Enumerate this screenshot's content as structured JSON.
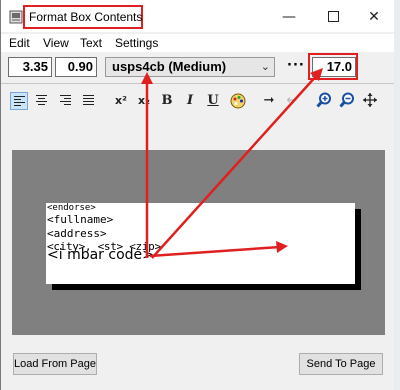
{
  "window": {
    "title": "Format Box Contents"
  },
  "menu": [
    "Edit",
    "View",
    "Text",
    "Settings"
  ],
  "fields": {
    "x": "3.35",
    "y": "0.90",
    "size": "17.0"
  },
  "font_select": {
    "value": "usps4cb (Medium)"
  },
  "dots_label": "···",
  "toolbar": [
    "align-left-icon",
    "align-center-icon",
    "align-right-icon",
    "justify-icon",
    "superscript-icon",
    "subscript-icon",
    "bold-icon",
    "italic-icon",
    "underline-icon",
    "color-palette-icon",
    "arrow-right-icon",
    "arrow-left-icon",
    "zoom-in-icon",
    "zoom-out-icon",
    "move-icon"
  ],
  "preview": {
    "lines": [
      "<endorse>",
      "<fullname>",
      "<address>",
      "<city>, <st> <zip>",
      "<i mbar code>"
    ]
  },
  "buttons": {
    "load": "Load From Page",
    "send": "Send To Page"
  },
  "accent": "#e02020"
}
